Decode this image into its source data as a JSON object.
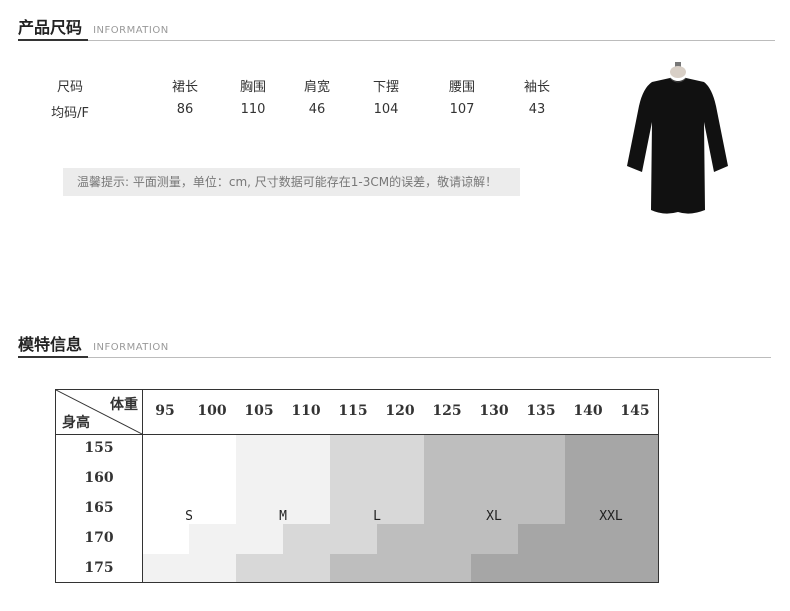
{
  "product_size_section": {
    "title": "产品尺码",
    "subtitle": "INFORMATION"
  },
  "size_table": {
    "headers": [
      "尺码",
      "裙长",
      "胸围",
      "肩宽",
      "下摆",
      "腰围",
      "袖长"
    ],
    "rows": [
      [
        "均码/F",
        "86",
        "110",
        "46",
        "104",
        "107",
        "43"
      ]
    ]
  },
  "tip": "温馨提示: 平面测量，单位：cm, 尺寸数据可能存在1-3CM的误差，敬请谅解！",
  "model_section": {
    "title": "模特信息",
    "subtitle": "INFORMATION"
  },
  "size_chart": {
    "corner_weight": "体重",
    "corner_height": "身高",
    "weights": [
      "95",
      "100",
      "105",
      "110",
      "115",
      "120",
      "125",
      "130",
      "135",
      "140",
      "145"
    ],
    "heights": [
      "155",
      "160",
      "165",
      "170",
      "175"
    ],
    "size_labels": [
      "S",
      "M",
      "L",
      "XL",
      "XXL"
    ],
    "band_colors": [
      "#ffffff",
      "#f2f2f2",
      "#d8d8d8",
      "#bebebe",
      "#a6a6a6"
    ]
  },
  "colors": {
    "rule": "#bcbcbc",
    "rule_accent": "#333333",
    "tip_background": "#ececec",
    "dress": "#111111"
  }
}
